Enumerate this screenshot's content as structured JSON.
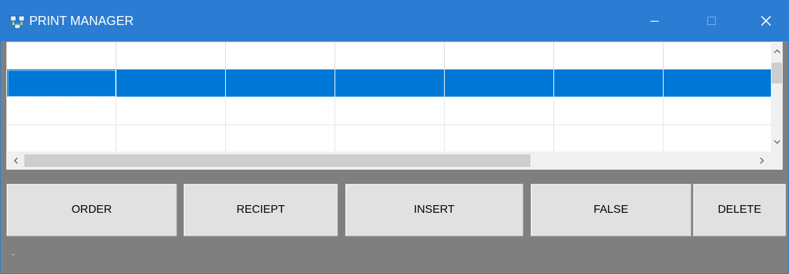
{
  "window": {
    "title": "PRINT MANAGER",
    "titlebar_color": "#2b7cd3",
    "icon": "network-computers-icon",
    "controls": [
      "minimize-icon",
      "maximize-icon",
      "close-icon"
    ]
  },
  "grid": {
    "columns": [
      "",
      "",
      "",
      "",
      "",
      "",
      ""
    ],
    "rows": [
      {
        "selected": true,
        "cells": [
          "",
          "",
          "",
          "",
          "",
          "",
          ""
        ]
      },
      {
        "selected": false,
        "cells": [
          "",
          "",
          "",
          "",
          "",
          "",
          ""
        ]
      },
      {
        "selected": false,
        "cells": [
          "",
          "",
          "",
          "",
          "",
          "",
          ""
        ]
      }
    ],
    "selection_color": "#0078d7"
  },
  "buttons": {
    "order": "ORDER",
    "receipt": "RECIEPT",
    "insert": "INSERT",
    "false": "FALSE",
    "delete": "DELETE"
  },
  "status": {
    "text": "."
  },
  "colors": {
    "panel_background": "#7f7f7f",
    "button_face": "#e1e1e1"
  }
}
